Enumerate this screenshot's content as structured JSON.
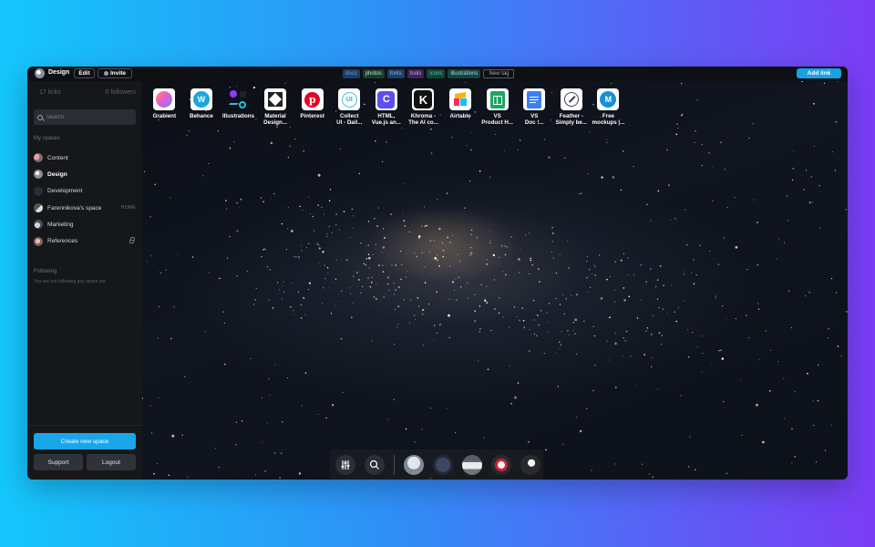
{
  "topbar": {
    "space_name": "Design",
    "edit_label": "Edit",
    "invite_label": "Invite",
    "tags": [
      {
        "label": "docs",
        "bg": "#1f3c63",
        "color": "#57a6ff"
      },
      {
        "label": "photos",
        "bg": "#1d3a2f",
        "color": "#b7e3c7"
      },
      {
        "label": "fonts",
        "bg": "#1f3c63",
        "color": "#7fb8ff"
      },
      {
        "label": "tools",
        "bg": "#3d2456",
        "color": "#d59bff"
      },
      {
        "label": "icons",
        "bg": "#14433a",
        "color": "#3fd3a4"
      },
      {
        "label": "illustrations",
        "bg": "#1a4040",
        "color": "#8fe6d8"
      }
    ],
    "new_tag_label": "New tag",
    "add_link_label": "Add link"
  },
  "sidebar": {
    "links_count": "17 links",
    "followers_count": "0 followers",
    "search_placeholder": "Search",
    "my_spaces_label": "My spaces",
    "spaces": [
      {
        "label": "Content",
        "right": ""
      },
      {
        "label": "Design",
        "right": ""
      },
      {
        "label": "Development",
        "right": ""
      },
      {
        "label": "Farennikova's space",
        "right": "HOME"
      },
      {
        "label": "Marketing",
        "right": ""
      },
      {
        "label": "References",
        "right": ""
      }
    ],
    "following_label": "Following",
    "following_empty": "You are not following any space yet",
    "create_label": "Create new space",
    "support_label": "Support",
    "logout_label": "Logout"
  },
  "shortcuts": [
    {
      "label": "Grabient",
      "icon": "grabient-icon"
    },
    {
      "label": "Behance",
      "icon": "behance-icon"
    },
    {
      "label": "Illustrations",
      "icon": "illustrations-icon"
    },
    {
      "label": "Material\nDesign...",
      "icon": "material-design-icon"
    },
    {
      "label": "Pinterest",
      "icon": "pinterest-icon"
    },
    {
      "label": "Collect\nUI - Dail...",
      "icon": "collect-ui-icon"
    },
    {
      "label": "HTML,\nVue.js an...",
      "icon": "html-vue-icon"
    },
    {
      "label": "Khroma -\nThe AI co...",
      "icon": "khroma-icon"
    },
    {
      "label": "Airtable",
      "icon": "airtable-icon"
    },
    {
      "label": "VS\nProduct H...",
      "icon": "sheets-icon"
    },
    {
      "label": "VS\nDoc !...",
      "icon": "docs-icon"
    },
    {
      "label": "Feather -\nSimply be...",
      "icon": "feather-icon"
    },
    {
      "label": "Free\nmockups |...",
      "icon": "mockups-icon"
    }
  ]
}
